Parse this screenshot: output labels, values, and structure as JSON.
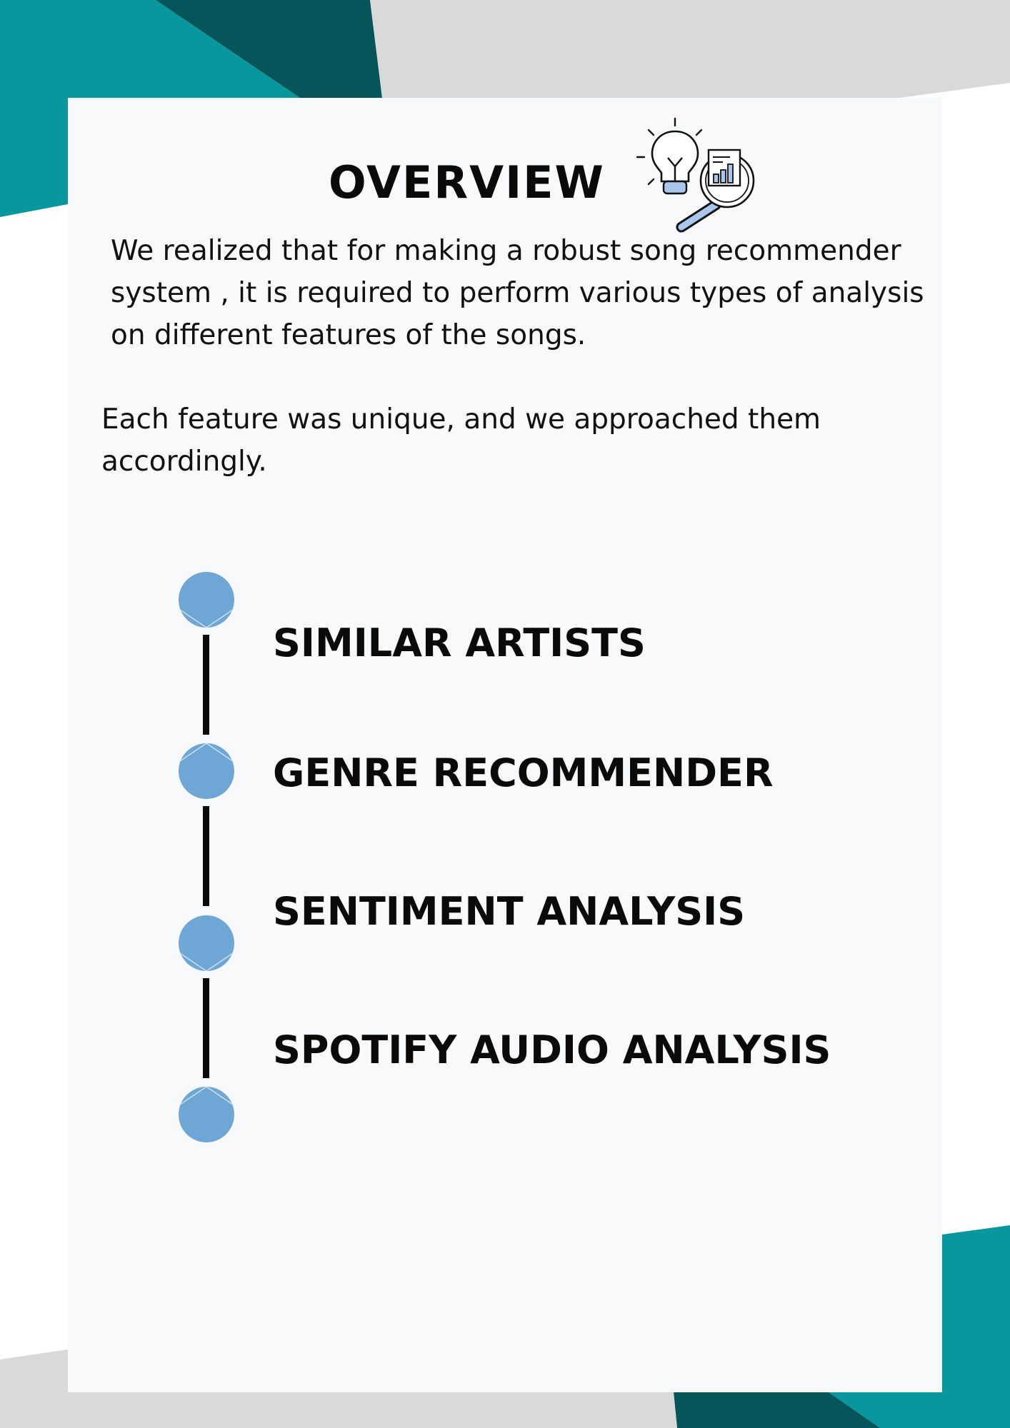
{
  "colors": {
    "teal": "#07979c",
    "dark_teal": "#05555a",
    "light_gray": "#d9d9d9",
    "card": "#f8f9fb",
    "node_blue": "#6ea6d5",
    "text": "#0a0a0a"
  },
  "header": {
    "title": "OVERVIEW",
    "icon": "lightbulb-magnifier-chart-icon"
  },
  "body": {
    "paragraph_1": "We realized that for making  a robust song recommender system , it is required to perform various types of analysis on different features of the songs.",
    "paragraph_2": "Each feature was unique, and we approached them accordingly."
  },
  "timeline": {
    "items": [
      {
        "label": "SIMILAR ARTISTS"
      },
      {
        "label": "GENRE RECOMMENDER"
      },
      {
        "label": "SENTIMENT ANALYSIS"
      },
      {
        "label": "SPOTIFY AUDIO ANALYSIS"
      }
    ]
  }
}
